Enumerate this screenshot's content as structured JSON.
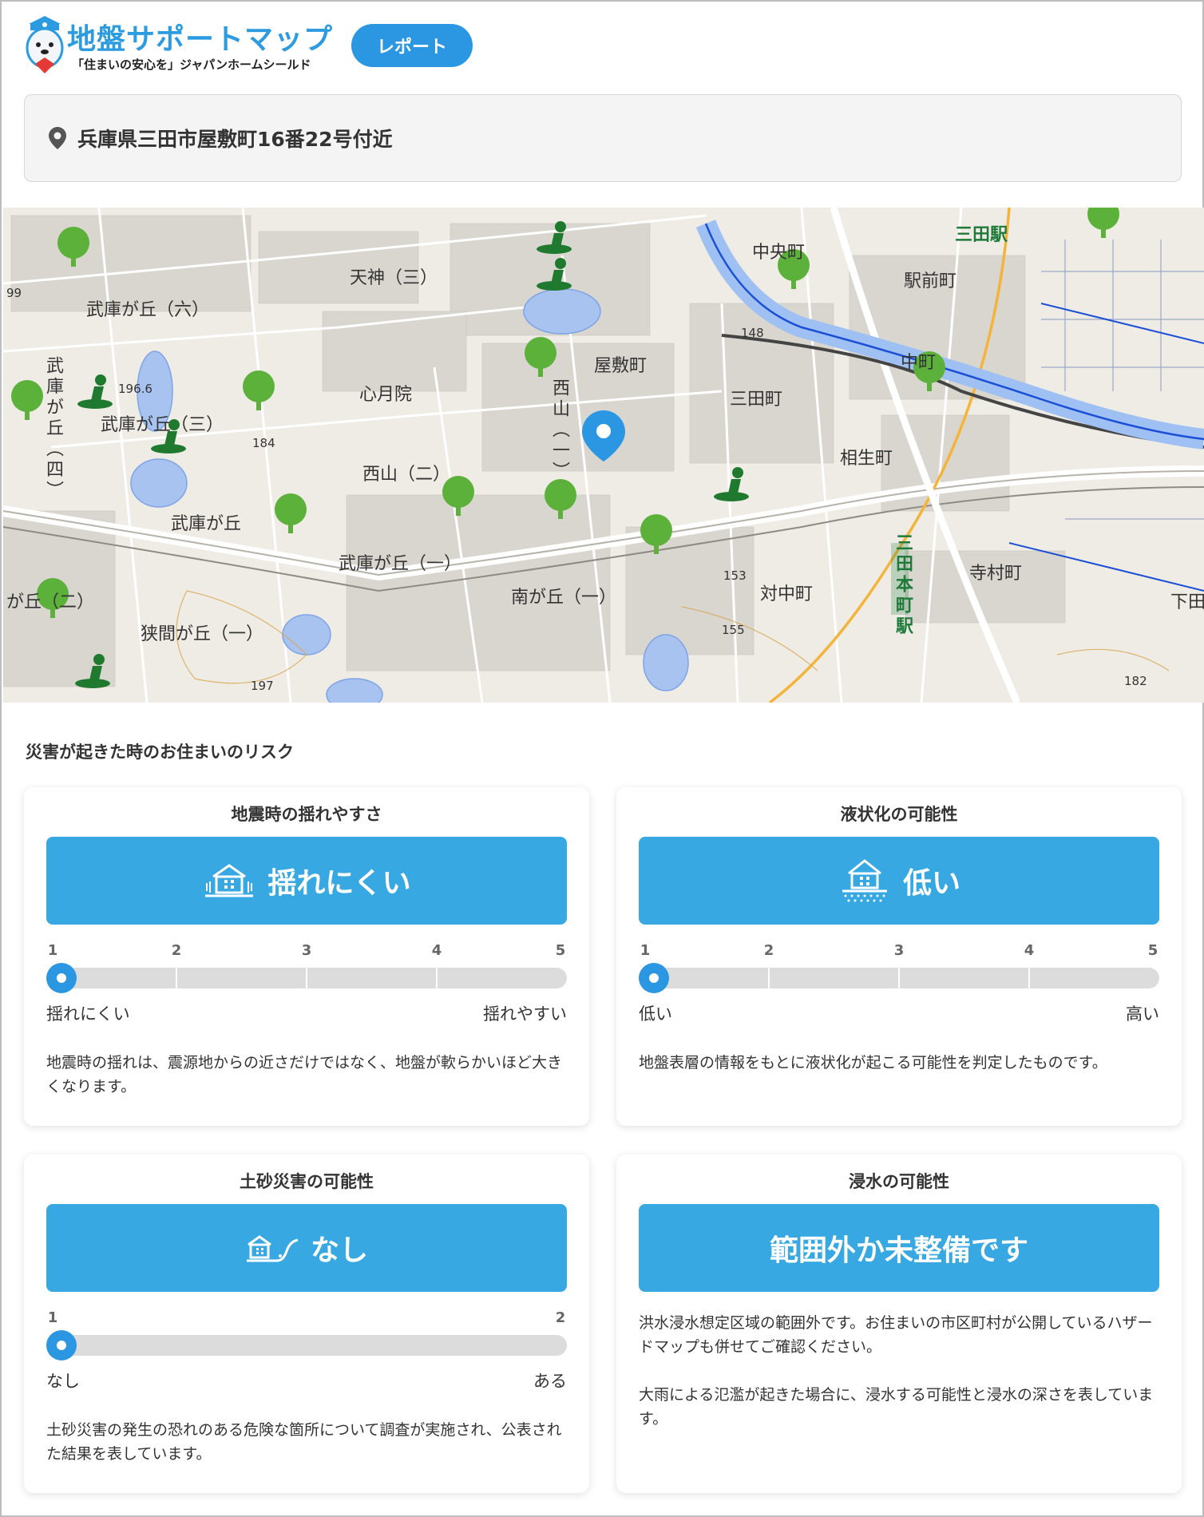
{
  "header": {
    "logo_title": "地盤サポートマップ",
    "logo_subtitle": "「住まいの安心を」ジャパンホームシールド",
    "report_button": "レポート"
  },
  "address": {
    "text": "兵庫県三田市屋敷町16番22号付近"
  },
  "map": {
    "labels": [
      {
        "text": "天神（三）",
        "vertical": false
      },
      {
        "text": "武庫が丘（六）",
        "vertical": false
      },
      {
        "text": "屋敷町",
        "vertical": false
      },
      {
        "text": "心月院",
        "vertical": false
      },
      {
        "text": "武庫が丘（三）",
        "vertical": false
      },
      {
        "text": "西山（二）",
        "vertical": false
      },
      {
        "text": "武庫が丘",
        "vertical": false
      },
      {
        "text": "武庫が丘（一）",
        "vertical": false
      },
      {
        "text": "南が丘（一）",
        "vertical": false
      },
      {
        "text": "狭間が丘（一）",
        "vertical": false
      },
      {
        "text": "三田町",
        "vertical": false
      },
      {
        "text": "相生町",
        "vertical": false
      },
      {
        "text": "駅前町",
        "vertical": false
      },
      {
        "text": "中央町",
        "vertical": false
      },
      {
        "text": "対中町",
        "vertical": false
      },
      {
        "text": "寺村町",
        "vertical": false
      },
      {
        "text": "下田",
        "vertical": false
      },
      {
        "text": "中町",
        "vertical": false
      },
      {
        "text": "が丘（二）",
        "vertical": false
      },
      {
        "text": "西山（一）",
        "vertical": true
      },
      {
        "text": "武庫が丘（四）",
        "vertical": true
      }
    ],
    "station_labels": [
      {
        "text": "三田駅",
        "vertical": false
      },
      {
        "text": "三田本町駅",
        "vertical": true
      }
    ],
    "elevations": [
      "196.6",
      "184",
      "148",
      "153",
      "155",
      "197",
      "182",
      "99"
    ],
    "colors": {
      "water": "#a8c3f0",
      "road": "#ffffff",
      "river": "#1a4fd6",
      "tree": "#5cb13a",
      "pin": "#2b97e3"
    }
  },
  "section_title": "災害が起きた時のお住まいのリスク",
  "cards": [
    {
      "title": "地震時の揺れやすさ",
      "result": "揺れにくい",
      "icon": "house-shake-icon",
      "scale": [
        "1",
        "2",
        "3",
        "4",
        "5"
      ],
      "level": 1,
      "max": 5,
      "left_label": "揺れにくい",
      "right_label": "揺れやすい",
      "description": "地震時の揺れは、震源地からの近さだけではなく、地盤が軟らかいほど大きくなります。"
    },
    {
      "title": "液状化の可能性",
      "result": "低い",
      "icon": "house-liquefaction-icon",
      "scale": [
        "1",
        "2",
        "3",
        "4",
        "5"
      ],
      "level": 1,
      "max": 5,
      "left_label": "低い",
      "right_label": "高い",
      "description": "地盤表層の情報をもとに液状化が起こる可能性を判定したものです。"
    },
    {
      "title": "土砂災害の可能性",
      "result": "なし",
      "icon": "house-landslide-icon",
      "scale": [
        "1",
        "2"
      ],
      "level": 1,
      "max": 2,
      "left_label": "なし",
      "right_label": "ある",
      "description": "土砂災害の発生の恐れのある危険な箇所について調査が実施され、公表された結果を表しています。"
    },
    {
      "title": "浸水の可能性",
      "result": "範囲外か未整備です",
      "description": "洪水浸水想定区域の範囲外です。お住まいの市区町村が公開しているハザードマップも併せてご確認ください。",
      "description2": "大雨による氾濫が起きた場合に、浸水する可能性と浸水の深さを表しています。"
    }
  ]
}
